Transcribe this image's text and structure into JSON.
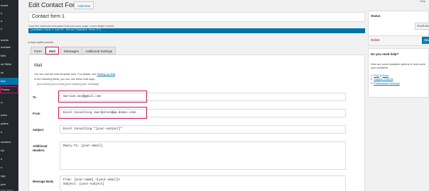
{
  "sidebar": {
    "items": [
      {
        "label": "board",
        "state": "normal"
      },
      {
        "label": "s",
        "state": "normal"
      },
      {
        "label": "a",
        "state": "normal"
      },
      {
        "label": "s",
        "state": "normal"
      },
      {
        "label": "ments",
        "state": "normal"
      },
      {
        "label": "monials",
        "state": "normal"
      },
      {
        "label": "folio",
        "state": "normal"
      },
      {
        "label": "ss Slider",
        "state": "normal"
      },
      {
        "label": "ss",
        "state": "normal"
      },
      {
        "label": "tact",
        "state": "current"
      },
      {
        "label": "Forms",
        "state": "sub-highlight"
      },
      {
        "label": "w",
        "state": "sub"
      },
      {
        "label": "entor",
        "state": "normal"
      },
      {
        "label": "plates",
        "state": "normal"
      },
      {
        "label": "s",
        "state": "normal"
      },
      {
        "label": "earance",
        "state": "normal"
      },
      {
        "label": "ins",
        "state": "normal"
      },
      {
        "label": "s",
        "state": "normal"
      },
      {
        "label": "s",
        "state": "normal"
      },
      {
        "label": "ngs",
        "state": "normal"
      },
      {
        "label": "port",
        "state": "normal"
      },
      {
        "label": "pse menu",
        "state": "collapse"
      }
    ]
  },
  "header": {
    "title": "Edit Contact Form",
    "add_new_label": "Add New",
    "help_label": "Help"
  },
  "form_title": {
    "value": "Contact form 1"
  },
  "shortcode": {
    "note": "Copy this shortcode and paste it into your post, page, or text widget content:",
    "code": "[contact-form-7 id=\"4\" title=\"Contact form 1\"]"
  },
  "switch_panels_label": "▸ keys switch panels",
  "tabs": [
    {
      "label": "Form",
      "active": false,
      "highlight": false
    },
    {
      "label": "Mail",
      "active": true,
      "highlight": true
    },
    {
      "label": "Messages",
      "active": false,
      "highlight": false
    },
    {
      "label": "Additional Settings",
      "active": false,
      "highlight": false
    }
  ],
  "mail": {
    "heading": "Mail",
    "help_line1_prefix": "You can edit the mail template here. For details, see ",
    "help_line1_link": "Setting Up Mail",
    "help_line1_suffix": ".",
    "help_line2": "In the following fields, you can use these mail-tags:",
    "tags": "[your-name] [your-email] [your-subject] [your-message]",
    "fields": {
      "to": {
        "label": "To",
        "value": "marsian.mcs@gmail.com"
      },
      "from": {
        "label": "From",
        "value": "Excel Consulting <wordpress@wp-demos.com>"
      },
      "subject": {
        "label": "Subject",
        "value": "Excel Consulting \"[your-subject]\""
      },
      "additional_headers": {
        "label_line1": "Additional",
        "label_line2": "Headers",
        "value": "Reply-To: [your-email]"
      },
      "message_body": {
        "label": "Message Body",
        "value": "From: [your-name] <[your-email]>\nSubject: [your-subject]"
      }
    }
  },
  "status_box": {
    "title": "Status",
    "duplicate_label": "Duplicate",
    "delete_label": "Delete",
    "save_label": "Save"
  },
  "help_box": {
    "title": "Do you need help?",
    "text": "Here are some available options to help solve your problems.",
    "links": [
      {
        "number": "1.",
        "label": "FAQ",
        "joiner": " & ",
        "label2": "Docs"
      },
      {
        "number": "2.",
        "label": "Support Forums",
        "joiner": "",
        "label2": ""
      },
      {
        "number": "3.",
        "label": "Professional Services",
        "joiner": "",
        "label2": ""
      }
    ]
  },
  "colors": {
    "accent": "#0073aa",
    "highlight": "#c2185b",
    "sidebar_bg": "#23282d",
    "delete": "#aa0000"
  }
}
